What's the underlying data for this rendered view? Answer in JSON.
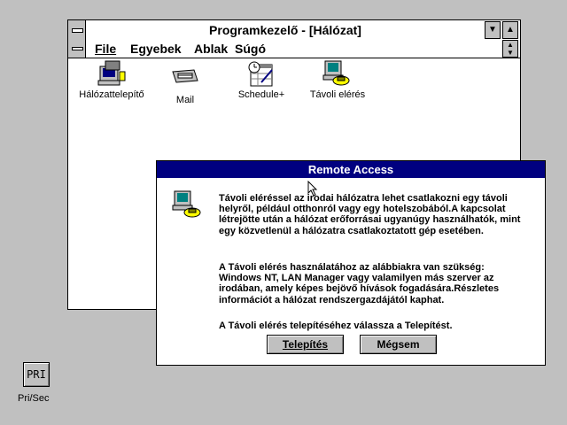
{
  "program_manager": {
    "title": "Programkezelő - [Hálózat]",
    "menu": {
      "file": "File",
      "egyebek": "Egyebek",
      "ablak": "Ablak",
      "sugo": "Súgó"
    },
    "icons": [
      {
        "label": "Hálózattelepítő",
        "icon": "network-setup-icon"
      },
      {
        "label": "Mail",
        "icon": "mail-icon"
      },
      {
        "label": "Schedule+",
        "icon": "schedule-icon"
      },
      {
        "label": "Távoli elérés",
        "icon": "remote-access-icon"
      }
    ]
  },
  "dialog": {
    "title": "Remote Access",
    "paragraph1": "Távoli eléréssel az irodai hálózatra lehet csatlakozni egy távoli helyről, például otthonról vagy egy hotelszobából.A kapcsolat létrejötte után a hálózat erőforrásai ugyanúgy használhatók, mint egy közvetlenül a hálózatra csatlakoztatott gép esetében.",
    "paragraph2": "A Távoli elérés használatához az alábbiakra van szükség: Windows NT, LAN Manager vagy valamilyen más szerver az irodában, amely képes bejövő hívások fogadására.Részletes információt a hálózat rendszergazdájától kaphat.",
    "paragraph3": "A Távoli elérés telepítéséhez válassza a Telepítést.",
    "install_button": "Telepítés",
    "cancel_button": "Mégsem"
  },
  "desktop": {
    "pri_icon_text": "PRI",
    "pri_label": "Pri/Sec"
  }
}
